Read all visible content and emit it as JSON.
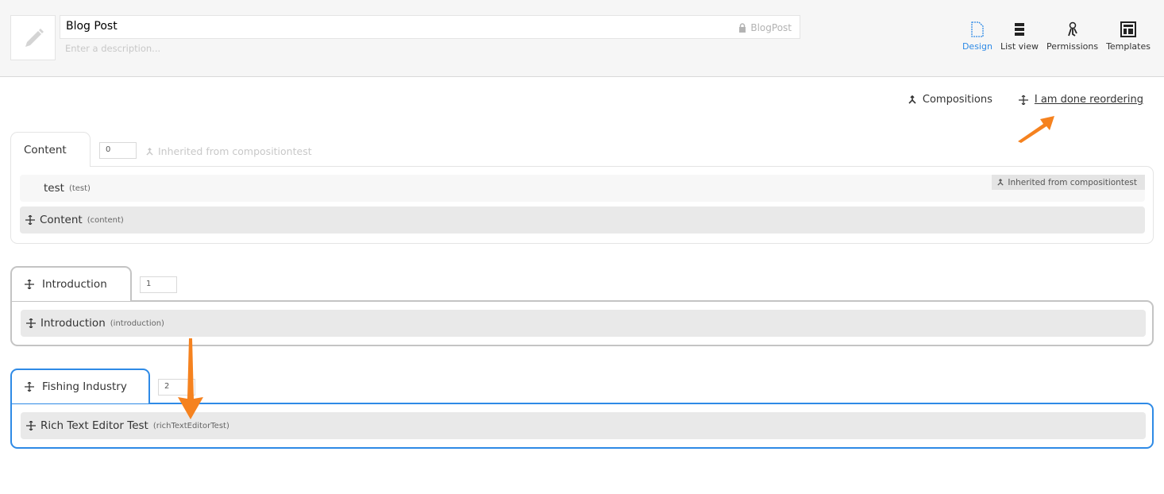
{
  "header": {
    "name_value": "Blog Post",
    "alias": "BlogPost",
    "description_placeholder": "Enter a description...",
    "icon": "pencil-icon",
    "nav": [
      {
        "label": "Design",
        "icon": "document-icon",
        "active": true
      },
      {
        "label": "List view",
        "icon": "list-icon",
        "active": false
      },
      {
        "label": "Permissions",
        "icon": "keys-icon",
        "active": false
      },
      {
        "label": "Templates",
        "icon": "template-icon",
        "active": false
      }
    ]
  },
  "toolbar": {
    "compositions_label": "Compositions",
    "reorder_label": "I am done reordering"
  },
  "groups": [
    {
      "tab_label": "Content",
      "sort_order": "0",
      "inherited_label": "Inherited from compositiontest",
      "properties": [
        {
          "name": "test",
          "alias": "(test)",
          "inherited_badge": "Inherited from compositiontest"
        },
        {
          "name": "Content",
          "alias": "(content)"
        }
      ]
    },
    {
      "tab_label": "Introduction",
      "sort_order": "1",
      "properties": [
        {
          "name": "Introduction",
          "alias": "(introduction)"
        }
      ]
    },
    {
      "tab_label": "Fishing Industry",
      "sort_order": "2",
      "properties": [
        {
          "name": "Rich Text Editor Test",
          "alias": "(richTextEditorTest)"
        }
      ]
    }
  ],
  "colors": {
    "accent": "#2e8ae6",
    "annotation_arrow": "#f5821f"
  }
}
